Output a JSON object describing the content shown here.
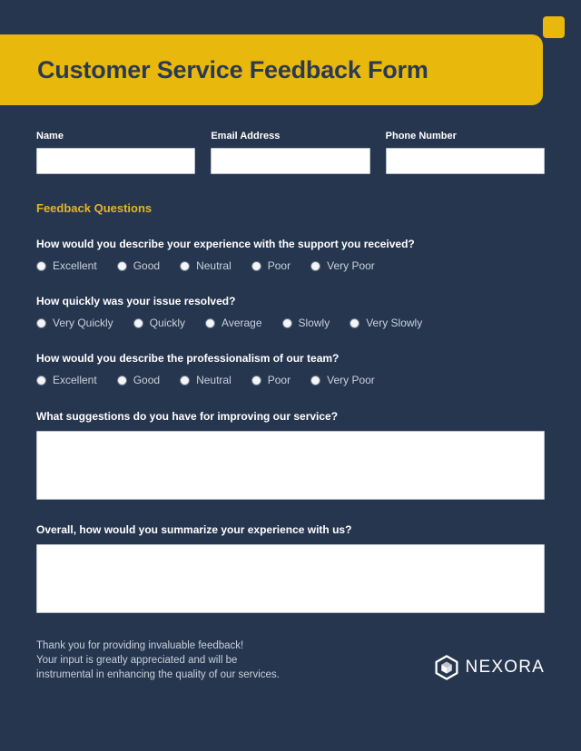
{
  "header": {
    "title": "Customer Service Feedback Form",
    "accent_color": "#e8b80c",
    "background_color": "#27364f"
  },
  "contact_fields": [
    {
      "label": "Name",
      "value": "",
      "placeholder": ""
    },
    {
      "label": "Email Address",
      "value": "",
      "placeholder": ""
    },
    {
      "label": "Phone Number",
      "value": "",
      "placeholder": ""
    }
  ],
  "section": {
    "title": "Feedback Questions",
    "title_color": "#e3b428"
  },
  "questions": [
    {
      "text": "How would you describe your experience with the support you received?",
      "options": [
        "Excellent",
        "Good",
        "Neutral",
        "Poor",
        "Very Poor"
      ]
    },
    {
      "text": "How quickly was your issue resolved?",
      "options": [
        "Very Quickly",
        "Quickly",
        "Average",
        "Slowly",
        "Very Slowly"
      ]
    },
    {
      "text": "How would you describe the professionalism of our team?",
      "options": [
        "Excellent",
        "Good",
        "Neutral",
        "Poor",
        "Very Poor"
      ]
    }
  ],
  "open_questions": [
    {
      "text": "What suggestions do you have for improving our service?",
      "value": "",
      "placeholder": ""
    },
    {
      "text": "Overall, how would you summarize your experience with us?",
      "value": "",
      "placeholder": ""
    }
  ],
  "footer": {
    "line1": "Thank you for providing invaluable feedback!",
    "line2": "Your input is greatly appreciated and will be",
    "line3": "instrumental in enhancing the quality of our services.",
    "brand": "NEXORA"
  }
}
